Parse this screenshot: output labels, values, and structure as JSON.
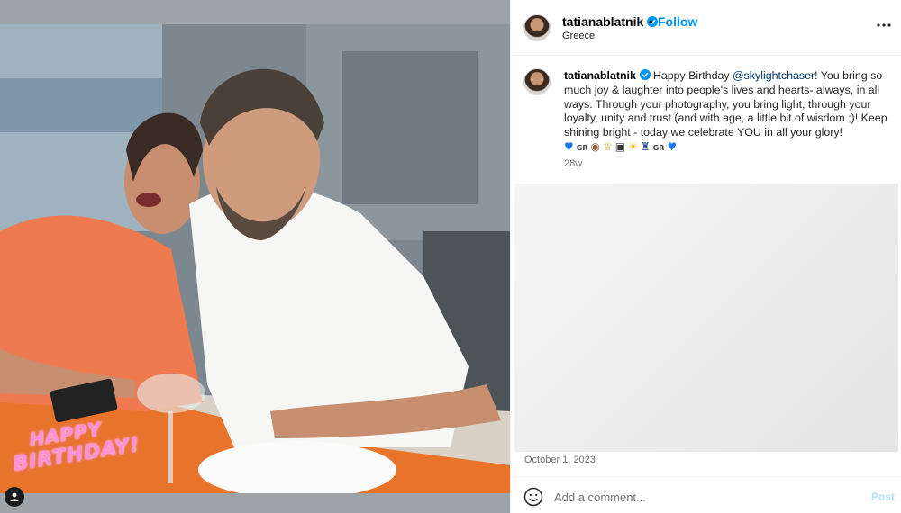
{
  "post": {
    "author": "tatianablatnik",
    "location": "Greece",
    "follow_label": "Follow",
    "separator": "•",
    "more_icon": "more-horizontal-icon"
  },
  "caption": {
    "author": "tatianablatnik",
    "text_before_mention": "Happy Birthday ",
    "mention": "@skylightchaser",
    "text_after_mention": "! You bring so much joy & laughter into people's lives and hearts- always, in all ways. Through your photography, you bring light, through your loyalty, unity and trust (and with age, a little bit of wisdom ;)! Keep shining bright - today we celebrate YOU in all your glory!",
    "emojis": [
      {
        "name": "blue-heart-icon",
        "glyph": "♥",
        "style": "blue"
      },
      {
        "name": "greece-flag-icon",
        "glyph": "GR",
        "style": "flag"
      },
      {
        "name": "cake-icon",
        "glyph": "◉",
        "style": "cake"
      },
      {
        "name": "trophy-icon",
        "glyph": "♕",
        "style": "trophy"
      },
      {
        "name": "camera-icon",
        "glyph": "▣",
        "style": "camera"
      },
      {
        "name": "sun-icon",
        "glyph": "☀",
        "style": "sun"
      },
      {
        "name": "bottle-icon",
        "glyph": "♜",
        "style": "bottle"
      },
      {
        "name": "greece-flag-icon",
        "glyph": "GR",
        "style": "flag"
      },
      {
        "name": "blue-heart-icon",
        "glyph": "♥",
        "style": "blue"
      }
    ],
    "time_ago": "28w"
  },
  "photo": {
    "sticker_line1": "HAPPY",
    "sticker_line2": "BIRTHDAY!"
  },
  "footer": {
    "date": "October 1, 2023",
    "comment_placeholder": "Add a comment...",
    "post_label": "Post"
  },
  "colors": {
    "link_blue": "#0095f6",
    "verified_blue": "#0095f6",
    "mention_navy": "#00376b",
    "muted_text": "#737373",
    "post_disabled": "#b2dffc"
  }
}
